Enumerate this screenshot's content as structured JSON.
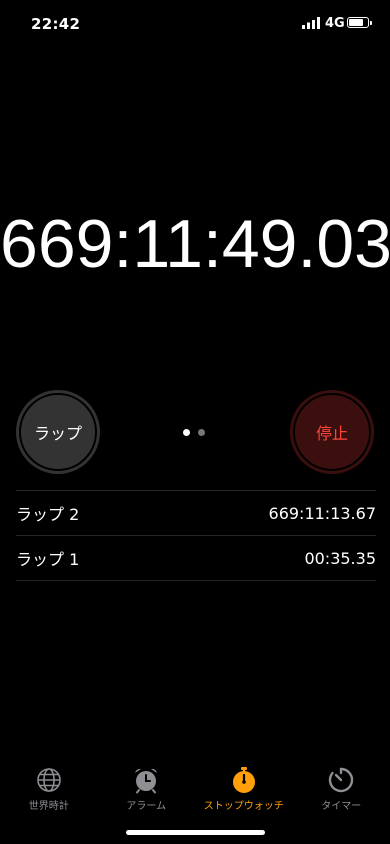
{
  "status_bar": {
    "time": "22:42",
    "network": "4G",
    "battery_level": 0.8
  },
  "stopwatch": {
    "time": "669:11:49.03"
  },
  "controls": {
    "lap_label": "ラップ",
    "stop_label": "停止"
  },
  "page_indicator": {
    "total": 2,
    "active_index": 0
  },
  "laps": [
    {
      "label": "ラップ 2",
      "time": "669:11:13.67"
    },
    {
      "label": "ラップ 1",
      "time": "00:35.35"
    }
  ],
  "tab_bar": {
    "tabs": [
      {
        "label": "世界時計",
        "icon": "globe-icon",
        "active": false
      },
      {
        "label": "アラーム",
        "icon": "alarm-clock-icon",
        "active": false
      },
      {
        "label": "ストップウォッチ",
        "icon": "stopwatch-icon",
        "active": true
      },
      {
        "label": "タイマー",
        "icon": "timer-icon",
        "active": false
      }
    ]
  },
  "colors": {
    "accent": "#ff9f0a",
    "stop_text": "#ff453a",
    "stop_bg": "#3a0f0d",
    "lap_bg": "#333333"
  }
}
